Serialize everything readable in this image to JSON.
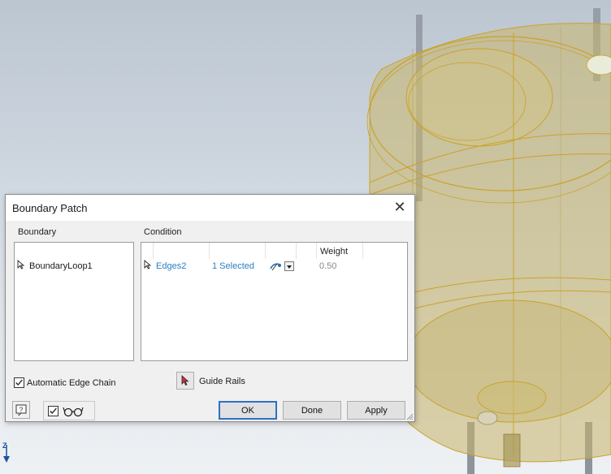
{
  "dialog": {
    "title": "Boundary Patch",
    "close_icon": "close-icon"
  },
  "boundary": {
    "header": "Boundary",
    "rows": [
      "BoundaryLoop1"
    ]
  },
  "condition": {
    "header": "Condition",
    "weight_header": "Weight",
    "rows": [
      {
        "edges": "Edges2",
        "selection": "1 Selected",
        "type_icon": "tangent-condition-icon",
        "weight": "0.50"
      }
    ]
  },
  "options": {
    "automatic_edge_chain": {
      "label": "Automatic Edge Chain",
      "checked": true
    },
    "guide_rails": {
      "label": "Guide Rails",
      "icon": "select-arrow-icon"
    },
    "preview": {
      "checked": true,
      "icon": "glasses-preview-icon"
    }
  },
  "buttons": {
    "ok": "OK",
    "done": "Done",
    "apply": "Apply"
  },
  "viewport": {
    "axis_label": "Z",
    "model_color": "#c8b56a",
    "edge_color": "#c9a227"
  }
}
